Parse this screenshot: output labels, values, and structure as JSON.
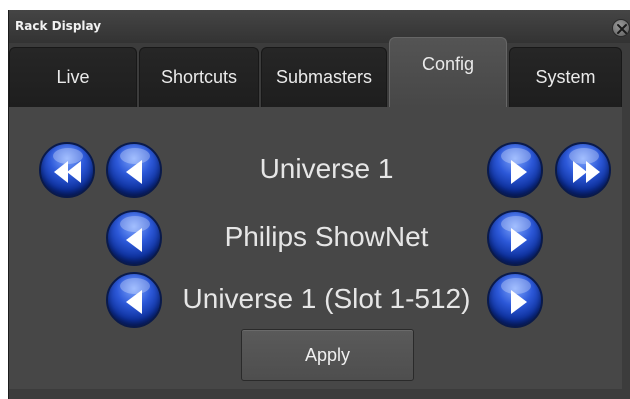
{
  "window": {
    "title": "Rack Display"
  },
  "tabs": [
    {
      "label": "Live",
      "active": false
    },
    {
      "label": "Shortcuts",
      "active": false
    },
    {
      "label": "Submasters",
      "active": false
    },
    {
      "label": "Config",
      "active": true
    },
    {
      "label": "System",
      "active": false
    }
  ],
  "config": {
    "universe_label": "Universe 1",
    "protocol_label": "Philips ShowNet",
    "slot_label": "Universe 1 (Slot 1-512)",
    "apply_label": "Apply"
  },
  "icons": {
    "close": "close-icon",
    "rewind": "rewind-icon",
    "fast_forward": "fast-forward-icon",
    "previous": "arrow-left-icon",
    "next": "arrow-right-icon"
  },
  "colors": {
    "window_bg": "#3c3c3c",
    "panel_bg": "#474747",
    "active_tab": "#545454",
    "button_blue": "#2c58d8"
  }
}
